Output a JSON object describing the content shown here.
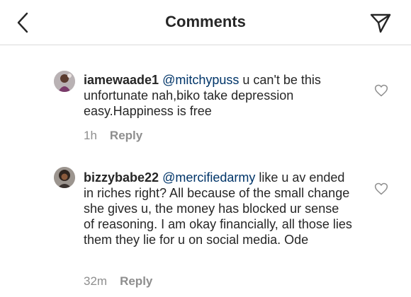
{
  "header": {
    "title": "Comments",
    "back_icon": "chevron-left-icon",
    "share_icon": "paper-plane-icon"
  },
  "comments": [
    {
      "username": "iamewaade1",
      "mention": "@mitchypuss",
      "text": " u can't be this unfortunate nah,biko take depression easy.Happiness is free",
      "time": "1h",
      "reply_label": "Reply",
      "like_icon": "heart-outline-icon"
    },
    {
      "username": "bizzybabe22",
      "mention": "@mercifiedarmy",
      "text": " like u av ended in riches right? All because of the small change she gives u, the money has blocked ur sense of reasoning. I am okay financially, all those lies them they lie for u on social media. Ode",
      "time": "32m",
      "reply_label": "Reply",
      "like_icon": "heart-outline-icon"
    }
  ],
  "colors": {
    "text": "#262626",
    "muted": "#8e8e8e",
    "mention": "#003569",
    "divider": "#dbdbdb"
  }
}
